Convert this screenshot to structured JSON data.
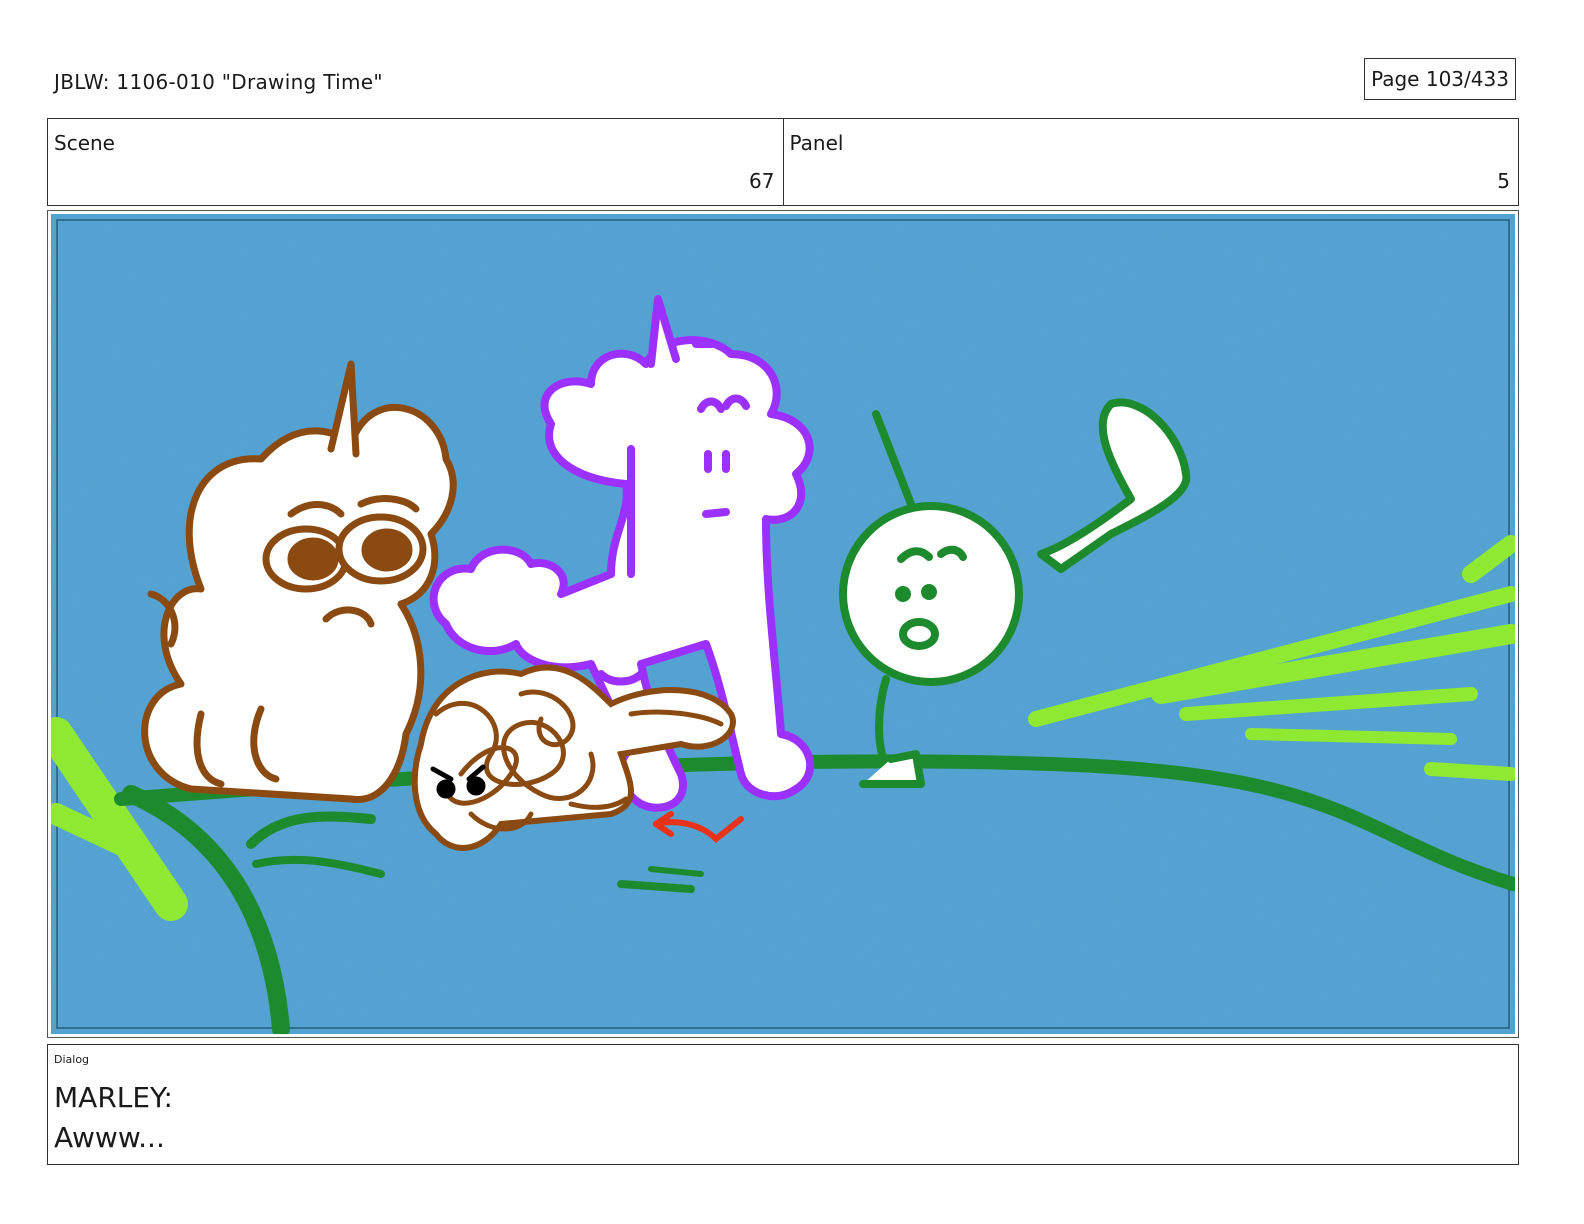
{
  "header": {
    "title": "JBLW: 1106-010 \"Drawing Time\"",
    "page": "Page 103/433"
  },
  "meta": {
    "scene_label": "Scene",
    "scene_value": "67",
    "panel_label": "Panel",
    "panel_value": "5"
  },
  "dialog": {
    "label": "Dialog",
    "speaker": "MARLEY:",
    "line": "Awww..."
  },
  "colors": {
    "sky": "#4fa3d4",
    "brown": "#8b4a12",
    "purple": "#9b30ff",
    "green": "#1e8a2e",
    "lime": "#8fe832",
    "red_arrow": "#e8331a"
  }
}
